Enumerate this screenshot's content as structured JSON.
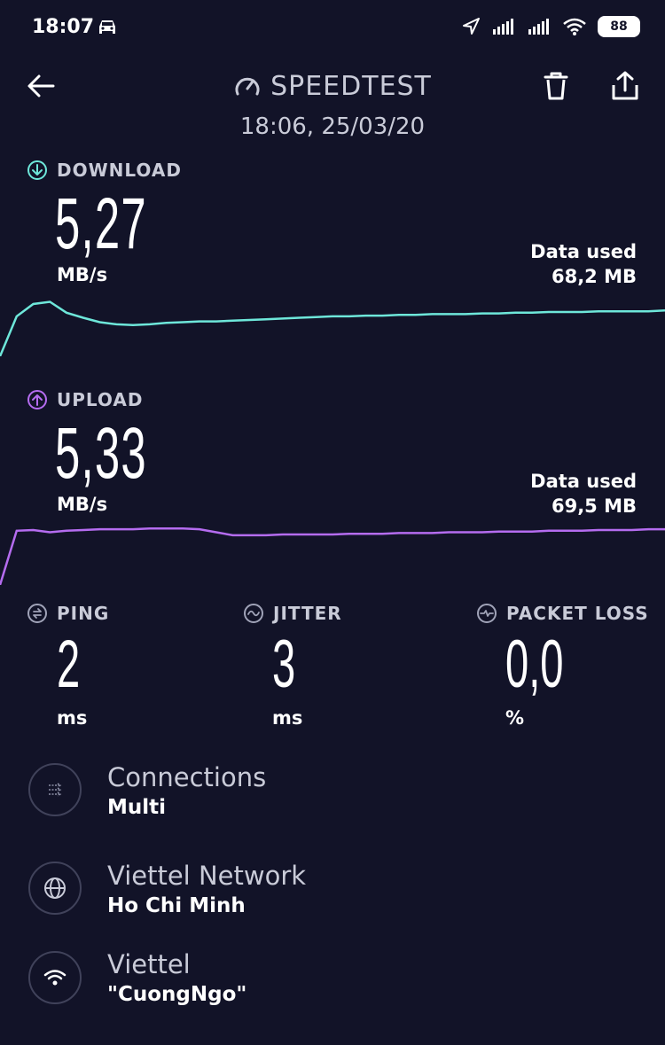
{
  "status_bar": {
    "time": "18:07",
    "battery": "88",
    "icons": [
      "car-icon",
      "location-arrow-icon",
      "signal-icon",
      "signal-icon",
      "wifi-icon",
      "battery-icon"
    ]
  },
  "header": {
    "title": "SPEEDTEST",
    "timestamp": "18:06, 25/03/20"
  },
  "download": {
    "label": "DOWNLOAD",
    "value": "5,27",
    "unit": "MB/s",
    "data_used_label": "Data used",
    "data_used_value": "68,2 MB",
    "color": "#6ee7da"
  },
  "upload": {
    "label": "UPLOAD",
    "value": "5,33",
    "unit": "MB/s",
    "data_used_label": "Data used",
    "data_used_value": "69,5 MB",
    "color": "#b56cf0"
  },
  "stats": {
    "ping": {
      "label": "PING",
      "value": "2",
      "unit": "ms"
    },
    "jitter": {
      "label": "JITTER",
      "value": "3",
      "unit": "ms"
    },
    "packet_loss": {
      "label": "PACKET LOSS",
      "value": "0,0",
      "unit": "%"
    }
  },
  "info": {
    "connections": {
      "title": "Connections",
      "value": "Multi"
    },
    "network": {
      "title": "Viettel Network",
      "value": "Ho Chi Minh"
    },
    "wifi": {
      "title": "Viettel",
      "value": "\"CuongNgo\""
    }
  },
  "chart_data": [
    {
      "type": "line",
      "series": [
        {
          "values": [
            0.0,
            0.55,
            0.72,
            0.75,
            0.6,
            0.53,
            0.47,
            0.44,
            0.43,
            0.44,
            0.46,
            0.47,
            0.48,
            0.48,
            0.49,
            0.5,
            0.51,
            0.52,
            0.53,
            0.54,
            0.55,
            0.55,
            0.56,
            0.56,
            0.57,
            0.57,
            0.58,
            0.58,
            0.58,
            0.59,
            0.59,
            0.6,
            0.6,
            0.61,
            0.61,
            0.61,
            0.62,
            0.62,
            0.62,
            0.62,
            0.63
          ]
        }
      ]
    },
    {
      "type": "line",
      "series": [
        {
          "values": [
            0.0,
            0.72,
            0.73,
            0.7,
            0.72,
            0.73,
            0.74,
            0.74,
            0.74,
            0.75,
            0.75,
            0.75,
            0.74,
            0.7,
            0.66,
            0.66,
            0.66,
            0.67,
            0.67,
            0.67,
            0.67,
            0.68,
            0.68,
            0.68,
            0.69,
            0.69,
            0.69,
            0.7,
            0.7,
            0.7,
            0.71,
            0.71,
            0.71,
            0.72,
            0.72,
            0.72,
            0.73,
            0.73,
            0.73,
            0.74,
            0.74
          ]
        }
      ]
    }
  ]
}
